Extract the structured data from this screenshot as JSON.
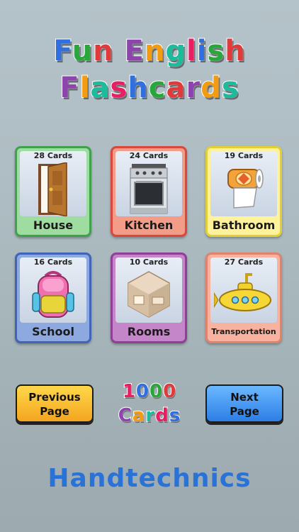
{
  "title": {
    "line1": "Fun English",
    "line2": "Flashcards"
  },
  "colors": {
    "title": [
      "#2f6fe0",
      "#28a83a",
      "#e13a3a",
      "#8e44ad",
      "#f39c12",
      "#1abc9c",
      "#e91e63"
    ],
    "brand": "#2a72d6"
  },
  "categories": [
    {
      "count": "28 Cards",
      "label": "House",
      "icon": "door-icon"
    },
    {
      "count": "24 Cards",
      "label": "Kitchen",
      "icon": "stove-icon"
    },
    {
      "count": "19 Cards",
      "label": "Bathroom",
      "icon": "toilet-paper-icon"
    },
    {
      "count": "16 Cards",
      "label": "School",
      "icon": "backpack-icon"
    },
    {
      "count": "10 Cards",
      "label": "Rooms",
      "icon": "room-icon"
    },
    {
      "count": "27 Cards",
      "label": "Transportation",
      "icon": "submarine-icon"
    }
  ],
  "navigation": {
    "prev_line1": "Previous",
    "prev_line2": "Page",
    "next_line1": "Next",
    "next_line2": "Page"
  },
  "total": {
    "line1": "1000",
    "line2": "Cards"
  },
  "brand": "Handtechnics"
}
